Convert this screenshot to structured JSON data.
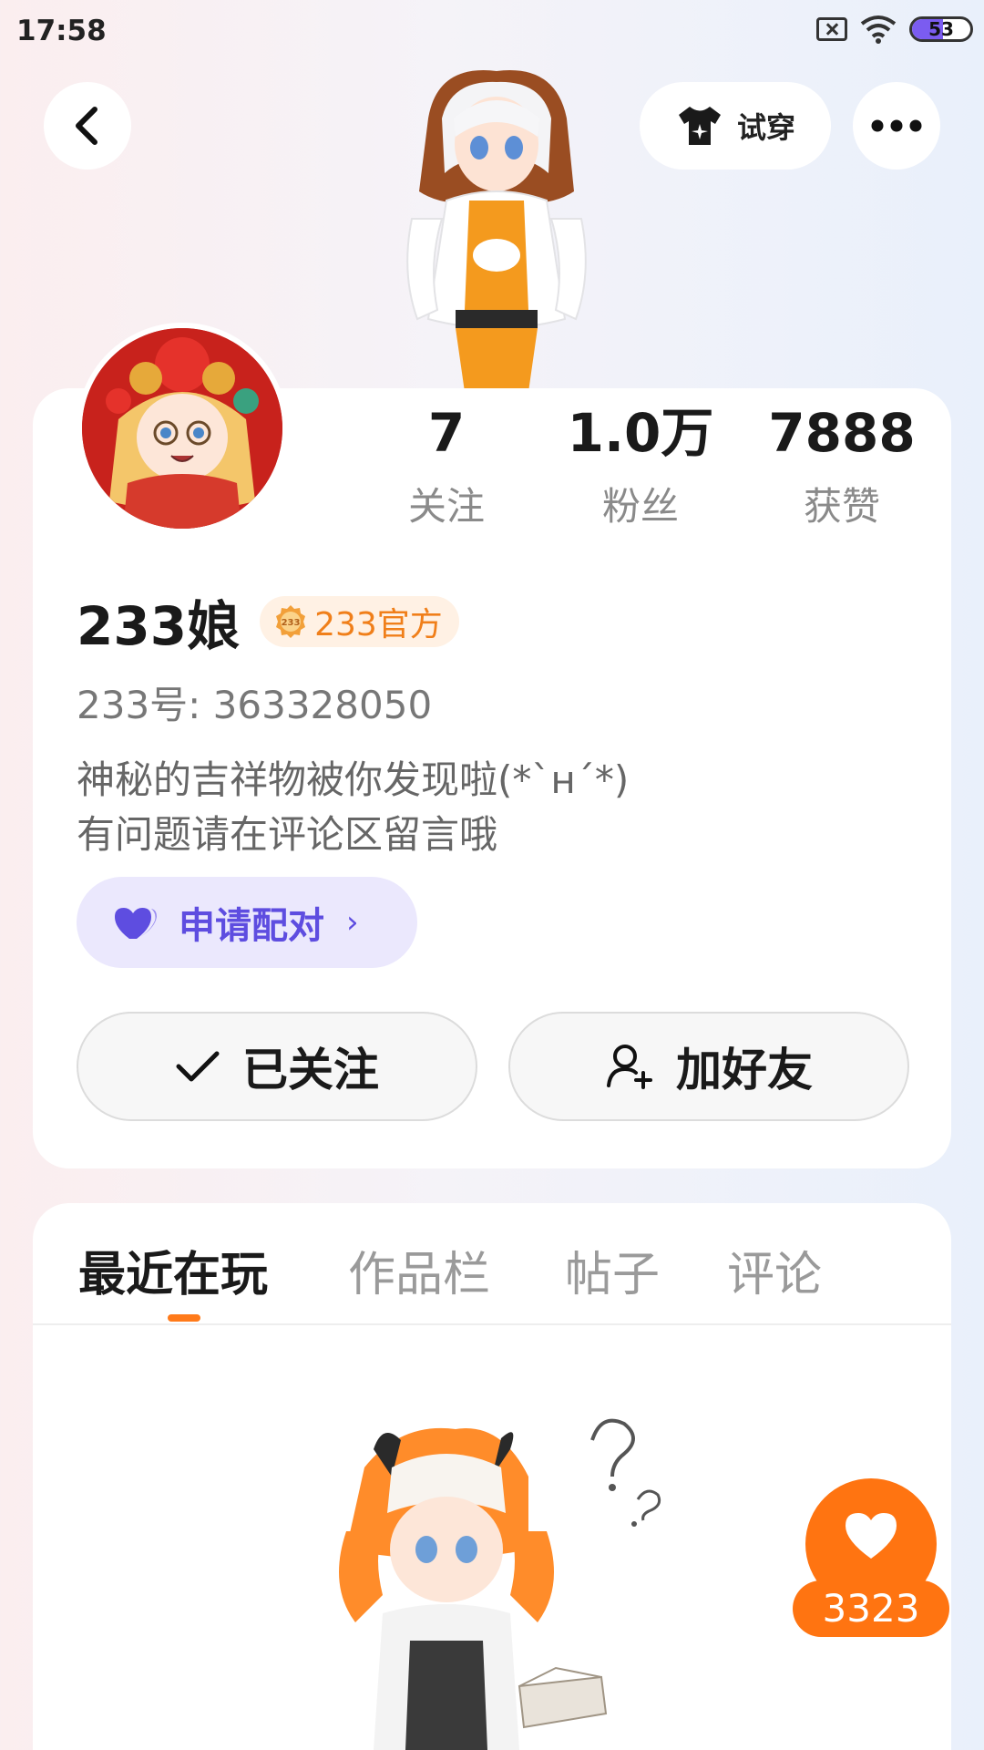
{
  "status_bar": {
    "time": "17:58",
    "battery": "53",
    "battery_level": 0.53
  },
  "header": {
    "try_on_label": "试穿"
  },
  "profile": {
    "stats": [
      {
        "value": "7",
        "label": "关注"
      },
      {
        "value": "1.0万",
        "label": "粉丝"
      },
      {
        "value": "7888",
        "label": "获赞"
      }
    ],
    "username": "233娘",
    "badge_text": "233官方",
    "badge_icon_text": "233",
    "user_id": "233号: 363328050",
    "bio_line1": "神秘的吉祥物被你发现啦(*`н´*)",
    "bio_line2": "有问题请在评论区留言哦",
    "pair_label": "申请配对",
    "pair_chevron": "›",
    "follow_label": "已关注",
    "add_friend_label": "加好友"
  },
  "tabs": [
    {
      "label": "最近在玩",
      "active": true
    },
    {
      "label": "作品栏",
      "active": false
    },
    {
      "label": "帖子",
      "active": false
    },
    {
      "label": "评论",
      "active": false
    }
  ],
  "like": {
    "count": "3323"
  },
  "colors": {
    "accent_orange": "#ff7411",
    "pair_purple": "#5e4de0",
    "badge_orange": "#f07f1a"
  },
  "icons": [
    "back-icon",
    "shirt-icon",
    "more-icon",
    "heart-icon",
    "check-icon",
    "add-user-icon",
    "official-medal-icon",
    "wifi-icon",
    "sim-icon"
  ]
}
